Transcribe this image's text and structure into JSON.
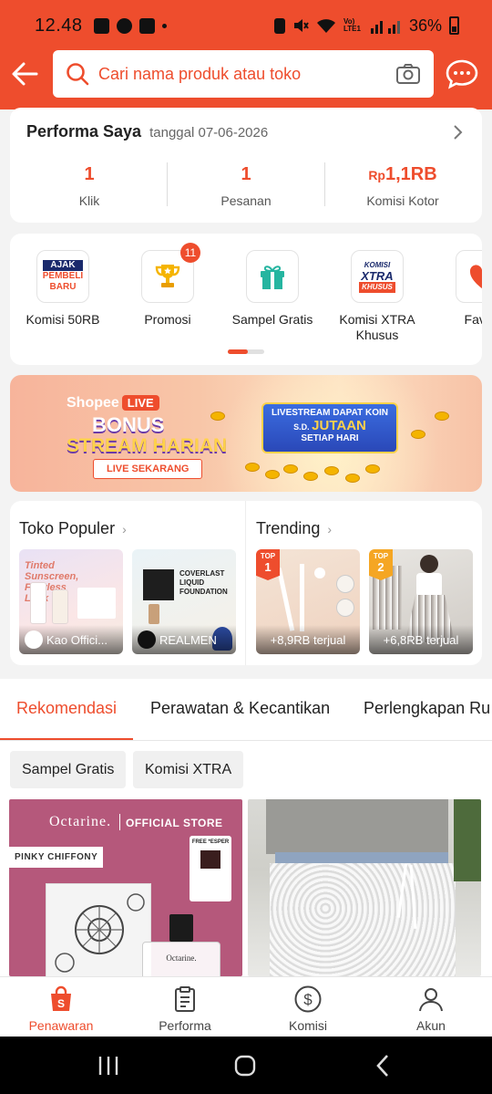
{
  "status_bar": {
    "time": "12.48",
    "battery": "36%",
    "network": "Vo) LTE1"
  },
  "search": {
    "placeholder": "Cari nama produk atau toko"
  },
  "performa": {
    "title": "Performa Saya",
    "date": "tanggal 07-06-2026",
    "metrics": [
      {
        "value": "1",
        "label": "Klik"
      },
      {
        "value": "1",
        "label": "Pesanan"
      },
      {
        "currency": "Rp",
        "value": "1,1RB",
        "label": "Komisi Kotor"
      }
    ]
  },
  "shortcuts": [
    {
      "label": "Komisi 50RB",
      "icon": "ajak-pembeli-baru-icon",
      "icon_text": [
        "AJAK",
        "PEMBELI",
        "BARU"
      ]
    },
    {
      "label": "Promosi",
      "icon": "trophy-icon",
      "badge": "11"
    },
    {
      "label": "Sampel Gratis",
      "icon": "gift-icon"
    },
    {
      "label": "Komisi XTRA Khusus",
      "icon": "komisi-xtra-icon",
      "icon_text": [
        "KOMISI",
        "XTRA",
        "KHUSUS"
      ]
    },
    {
      "label": "Favori",
      "icon": "heart-icon"
    }
  ],
  "banner": {
    "brand": "Shopee",
    "live": "LIVE",
    "line1": "BONUS",
    "line2": "STREAM HARIAN",
    "cta": "LIVE SEKARANG",
    "board_line1": "LIVESTREAM DAPAT KOIN",
    "board_prefix": "S.D.",
    "board_highlight": "JUTAAN",
    "board_line3": "SETIAP HARI"
  },
  "toko_populer": {
    "title": "Toko Populer",
    "items": [
      {
        "name": "Kao Offici...",
        "image_text": "Tinted Sunscreen, Flawless Look"
      },
      {
        "name": "REALMEN",
        "image_text": "COVERLAST LIQUID FOUNDATION"
      }
    ]
  },
  "trending": {
    "title": "Trending",
    "items": [
      {
        "rank_label": "TOP",
        "rank": "1",
        "sold": "+8,9RB terjual"
      },
      {
        "rank_label": "TOP",
        "rank": "2",
        "sold": "+6,8RB terjual"
      }
    ]
  },
  "tabs": [
    "Rekomendasi",
    "Perawatan & Kecantikan",
    "Perlengkapan Ru"
  ],
  "filters": [
    "Sampel Gratis",
    "Komisi XTRA"
  ],
  "products": [
    {
      "brand": "Octarine.",
      "store": "OFFICIAL STORE",
      "label": "PINKY CHIFFONY",
      "free_text": "FREE *ESPER",
      "bottle": "Octarine."
    },
    {
      "brand": ""
    }
  ],
  "bottom_nav": [
    {
      "label": "Penawaran",
      "icon": "shopping-bag-icon",
      "active": true
    },
    {
      "label": "Performa",
      "icon": "clipboard-icon"
    },
    {
      "label": "Komisi",
      "icon": "dollar-circle-icon"
    },
    {
      "label": "Akun",
      "icon": "user-icon"
    }
  ],
  "colors": {
    "brand": "#ee4d2d",
    "background": "#f3f3f3"
  }
}
